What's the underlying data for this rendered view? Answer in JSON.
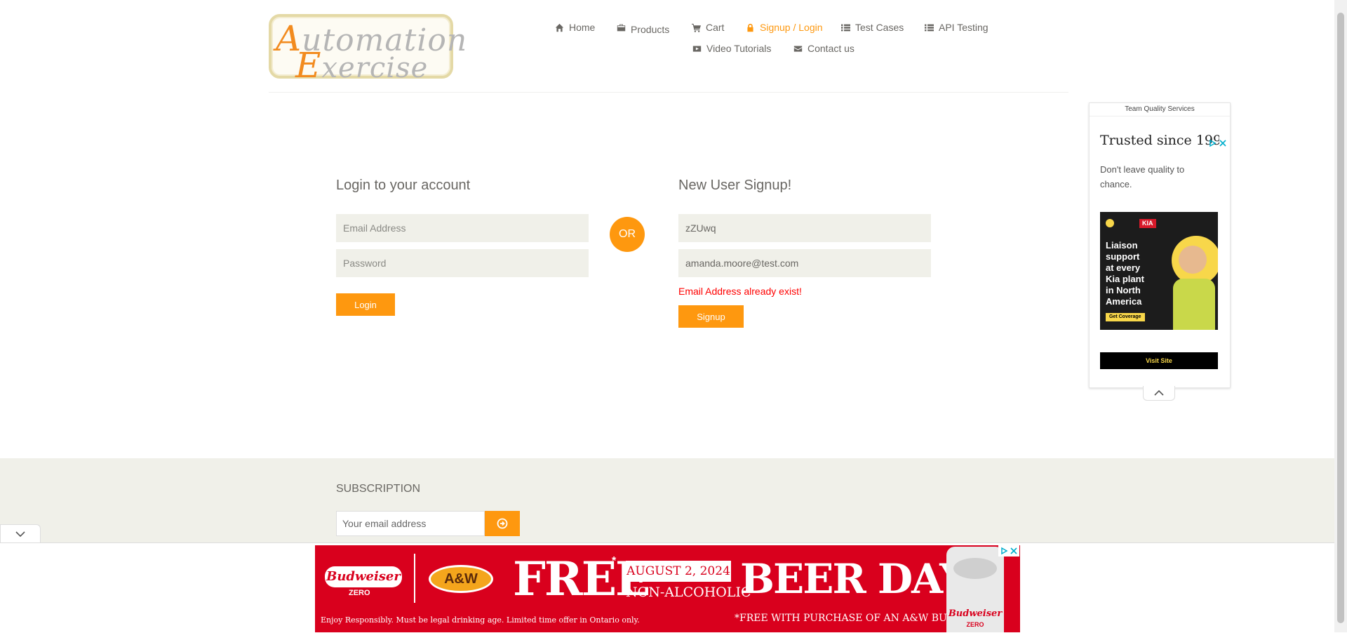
{
  "logo": {
    "line1_first": "A",
    "line1_rest": "utomation",
    "line2_first": "E",
    "line2_rest": "xercise"
  },
  "nav": [
    {
      "label": "Home",
      "icon": "home-icon"
    },
    {
      "label": "Products",
      "icon": "products-icon"
    },
    {
      "label": "Cart",
      "icon": "cart-icon"
    },
    {
      "label": "Signup / Login",
      "icon": "lock-icon",
      "active": true
    },
    {
      "label": "Test Cases",
      "icon": "list-icon"
    },
    {
      "label": "API Testing",
      "icon": "list-icon"
    },
    {
      "label": "Video Tutorials",
      "icon": "youtube-icon"
    },
    {
      "label": "Contact us",
      "icon": "envelope-icon"
    }
  ],
  "login": {
    "title": "Login to your account",
    "email_placeholder": "Email Address",
    "password_placeholder": "Password",
    "button": "Login"
  },
  "or_label": "OR",
  "signup": {
    "title": "New User Signup!",
    "name_value": "zZUwq",
    "email_value": "amanda.moore@test.com",
    "error": "Email Address already exist!",
    "button": "Signup"
  },
  "subscription": {
    "title": "SUBSCRIPTION",
    "placeholder": "Your email address"
  },
  "side_ad": {
    "source": "Team Quality Services",
    "headline": "Trusted since 199",
    "subtext": "Don't leave quality to chance.",
    "image_text": [
      "Liaison",
      "support",
      "at every",
      "Kia plant",
      "in North",
      "America"
    ],
    "image_cta": "Get Coverage",
    "image_brand": "KIA",
    "visit_label": "Visit Site"
  },
  "bottom_ad": {
    "brand1": "Budweiser",
    "brand1_sub": "ZERO",
    "brand2": "A&W",
    "free": "FREE",
    "asterisk": "*",
    "date": "AUGUST 2, 2024",
    "nonalc": "NON-ALCOHOLIC",
    "beer_day": "BEER DAY",
    "disclaimer": "Enjoy Responsibly. Must be legal drinking age. Limited time offer in Ontario only.",
    "footnote": "*FREE WITH PURCHASE OF AN A&W BURGER.",
    "can_brand": "Budweiser",
    "can_sub": "ZERO"
  },
  "colors": {
    "accent": "#fe980f",
    "field_bg": "#f0f0e9",
    "error": "#ff0000",
    "banner_red": "#d9001d"
  }
}
